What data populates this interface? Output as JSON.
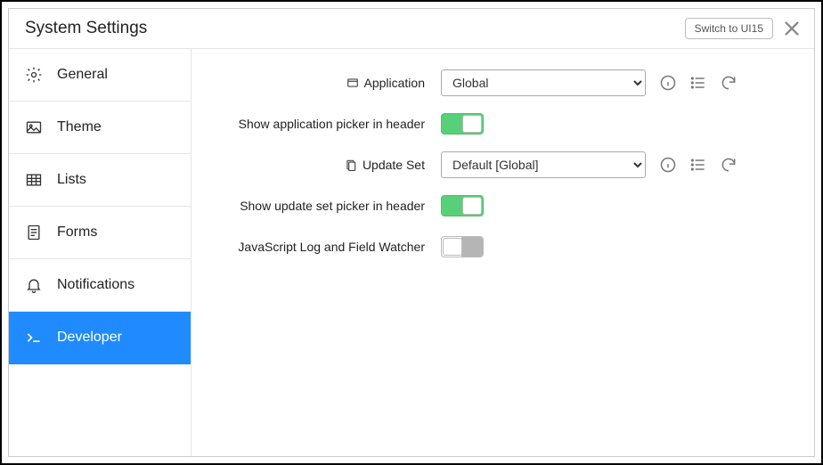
{
  "header": {
    "title": "System Settings",
    "switch_label": "Switch to UI15"
  },
  "sidebar": {
    "items": [
      {
        "label": "General"
      },
      {
        "label": "Theme"
      },
      {
        "label": "Lists"
      },
      {
        "label": "Forms"
      },
      {
        "label": "Notifications"
      },
      {
        "label": "Developer"
      }
    ]
  },
  "form": {
    "application_label": "Application",
    "application_value": "Global",
    "show_app_picker_label": "Show application picker in header",
    "show_app_picker_on": true,
    "update_set_label": "Update Set",
    "update_set_value": "Default [Global]",
    "show_update_set_picker_label": "Show update set picker in header",
    "show_update_set_picker_on": true,
    "js_log_label": "JavaScript Log and Field Watcher",
    "js_log_on": false
  }
}
